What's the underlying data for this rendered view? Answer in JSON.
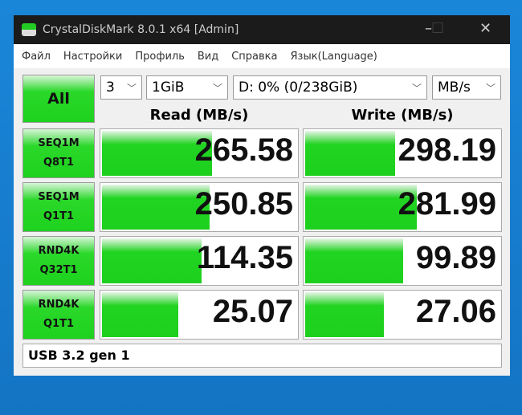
{
  "window": {
    "title": "CrystalDiskMark 8.0.1 x64 [Admin]",
    "minimize": "–",
    "maximize": "☐",
    "close": "✕"
  },
  "menu": [
    "Файл",
    "Настройки",
    "Профиль",
    "Вид",
    "Справка",
    "Язык(Language)"
  ],
  "controls": {
    "all_label": "All",
    "count": "3",
    "size": "1GiB",
    "drive": "D: 0% (0/238GiB)",
    "unit": "MB/s"
  },
  "headers": {
    "read": "Read (MB/s)",
    "write": "Write (MB/s)"
  },
  "rows": [
    {
      "line1": "SEQ1M",
      "line2": "Q8T1",
      "read": "265.58",
      "write": "298.19",
      "read_fill": 0.56,
      "write_fill": 0.46
    },
    {
      "line1": "SEQ1M",
      "line2": "Q1T1",
      "read": "250.85",
      "write": "281.99",
      "read_fill": 0.55,
      "write_fill": 0.57
    },
    {
      "line1": "RND4K",
      "line2": "Q32T1",
      "read": "114.35",
      "write": "99.89",
      "read_fill": 0.51,
      "write_fill": 0.5
    },
    {
      "line1": "RND4K",
      "line2": "Q1T1",
      "read": "25.07",
      "write": "27.06",
      "read_fill": 0.39,
      "write_fill": 0.4
    }
  ],
  "status": "USB 3.2 gen 1"
}
